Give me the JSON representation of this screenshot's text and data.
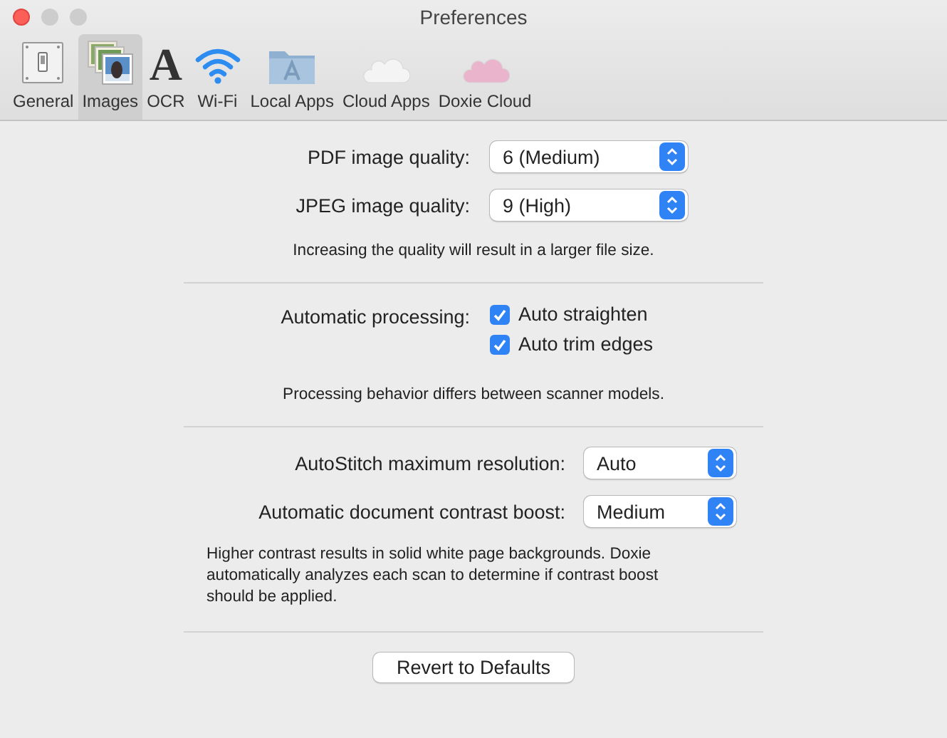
{
  "window": {
    "title": "Preferences"
  },
  "tabs": [
    {
      "label": "General",
      "kind": "switch",
      "selected": false
    },
    {
      "label": "Images",
      "kind": "photos",
      "selected": true
    },
    {
      "label": "OCR",
      "kind": "letter",
      "glyph": "A",
      "selected": false
    },
    {
      "label": "Wi-Fi",
      "kind": "wifi",
      "selected": false
    },
    {
      "label": "Local Apps",
      "kind": "folder",
      "selected": false
    },
    {
      "label": "Cloud Apps",
      "kind": "cloud",
      "color": "#f4f4f4",
      "selected": false
    },
    {
      "label": "Doxie Cloud",
      "kind": "cloud",
      "color": "#eab4cc",
      "selected": false
    }
  ],
  "quality": {
    "rows": [
      {
        "label": "PDF image quality:",
        "value": "6 (Medium)"
      },
      {
        "label": "JPEG image quality:",
        "value": "9 (High)"
      }
    ],
    "note": "Increasing the quality will result in a larger file size."
  },
  "processing": {
    "label": "Automatic processing:",
    "options": [
      {
        "label": "Auto straighten",
        "checked": true
      },
      {
        "label": "Auto trim edges",
        "checked": true
      }
    ],
    "note": "Processing behavior differs between scanner models."
  },
  "stitch": {
    "rows": [
      {
        "label": "AutoStitch maximum resolution:",
        "value": "Auto"
      },
      {
        "label": "Automatic document contrast boost:",
        "value": "Medium"
      }
    ],
    "note": "Higher contrast results in solid white page backgrounds. Doxie automatically analyzes each scan to determine if contrast boost should be applied."
  },
  "revert_button": "Revert to Defaults"
}
